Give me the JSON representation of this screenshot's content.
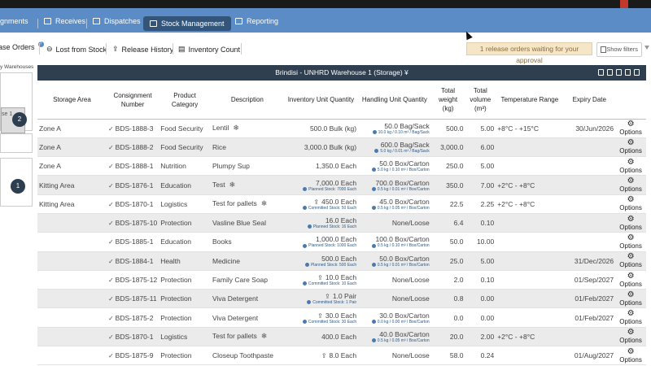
{
  "nav": {
    "items": [
      {
        "label": "ignments"
      },
      {
        "label": "Receives"
      },
      {
        "label": "Dispatches"
      },
      {
        "label": "Stock Management"
      },
      {
        "label": "Reporting"
      }
    ]
  },
  "toolbar": {
    "release_orders": "ase Orders",
    "release_orders_badge": "?",
    "lost_from_stock": "Lost from Stock",
    "release_history": "Release History",
    "inventory_count": "Inventory Count",
    "approval_notice": "1 release orders waiting for your approval",
    "show_filters": "Show filters"
  },
  "left_panel": {
    "title": "y Warehouses",
    "selected_label": "se 1",
    "node_1": "2",
    "node_2": "1"
  },
  "panel": {
    "title": "Brindisi - UNHRD Warehouse 1 (Storage) ¥"
  },
  "table": {
    "headers": [
      "Storage Area",
      "Consignment Number",
      "Product Category",
      "Description",
      "Inventory Unit Quantity",
      "Handling Unit Quantity",
      "Total weight (kg)",
      "Total volume (m³)",
      "Temperature Range",
      "Expiry Date",
      ""
    ],
    "options_label": "Options",
    "rows": [
      {
        "area": "Zone A",
        "cons": "BDS-1888-3",
        "cat": "Food Security",
        "desc": "Lentil",
        "snow": true,
        "share": false,
        "inv": "500.0 Bulk (kg)",
        "inv_sub": "",
        "hu": "50.0 Bag/Sack",
        "hu_sub": "10.0 kg / 0.10 m³ / Bag/Sack",
        "w": "500.0",
        "v": "5.00",
        "temp": "+8°C - +15°C",
        "exp": "30/Jun/2026"
      },
      {
        "area": "Zone A",
        "cons": "BDS-1888-2",
        "cat": "Food Security",
        "desc": "Rice",
        "snow": false,
        "share": false,
        "inv": "3,000.0 Bulk (kg)",
        "inv_sub": "",
        "hu": "600.0 Bag/Sack",
        "hu_sub": "5.0 kg / 0.01 m³ / Bag/Sack",
        "w": "3,000.0",
        "v": "6.00",
        "temp": "",
        "exp": ""
      },
      {
        "area": "Zone A",
        "cons": "BDS-1888-1",
        "cat": "Nutrition",
        "desc": "Plumpy Sup",
        "snow": false,
        "share": false,
        "inv": "1,350.0 Each",
        "inv_sub": "",
        "hu": "50.0 Box/Carton",
        "hu_sub": "5.0 kg / 0.10 m³ / Box/Carton",
        "w": "250.0",
        "v": "5.00",
        "temp": "",
        "exp": ""
      },
      {
        "area": "Kitting Area",
        "cons": "BDS-1876-1",
        "cat": "Education",
        "desc": "Test",
        "snow": true,
        "share": false,
        "inv": "7,000.0 Each",
        "inv_sub": "Planned Stock: 7000 Each",
        "hu": "700.0 Box/Carton",
        "hu_sub": "0.5 kg / 0.01 m³ / Box/Carton",
        "w": "350.0",
        "v": "7.00",
        "temp": "+2°C - +8°C",
        "exp": ""
      },
      {
        "area": "Kitting Area",
        "cons": "BDS-1870-1",
        "cat": "Logistics",
        "desc": "Test for pallets",
        "snow": true,
        "share": true,
        "inv": "450.0 Each",
        "inv_sub": "Committed Stock: 50 Each",
        "hu": "45.0 Box/Carton",
        "hu_sub": "0.5 kg / 0.05 m³ / Box/Carton",
        "w": "22.5",
        "v": "2.25",
        "temp": "+2°C - +8°C",
        "exp": ""
      },
      {
        "area": "",
        "cons": "BDS-1875-10",
        "cat": "Protection",
        "desc": "Vasline Blue Seal",
        "snow": false,
        "share": false,
        "inv": "16.0 Each",
        "inv_sub": "Planned Stock: 16 Each",
        "hu": "None/Loose",
        "hu_sub": "",
        "w": "6.4",
        "v": "0.10",
        "temp": "",
        "exp": ""
      },
      {
        "area": "",
        "cons": "BDS-1885-1",
        "cat": "Education",
        "desc": "Books",
        "snow": false,
        "share": false,
        "inv": "1,000.0 Each",
        "inv_sub": "Planned Stock: 1000 Each",
        "hu": "100.0 Box/Carton",
        "hu_sub": "0.5 kg / 0.10 m³ / Box/Carton",
        "w": "50.0",
        "v": "10.00",
        "temp": "",
        "exp": ""
      },
      {
        "area": "",
        "cons": "BDS-1884-1",
        "cat": "Health",
        "desc": "Medicine",
        "snow": false,
        "share": false,
        "inv": "500.0 Each",
        "inv_sub": "Planned Stock: 500 Each",
        "hu": "50.0 Box/Carton",
        "hu_sub": "0.5 kg / 0.01 m³ / Box/Carton",
        "w": "25.0",
        "v": "5.00",
        "temp": "",
        "exp": "31/Dec/2026"
      },
      {
        "area": "",
        "cons": "BDS-1875-12",
        "cat": "Protection",
        "desc": "Family Care Soap",
        "snow": false,
        "share": true,
        "inv": "10.0 Each",
        "inv_sub": "Committed Stock: 10 Each",
        "hu": "None/Loose",
        "hu_sub": "",
        "w": "2.0",
        "v": "0.10",
        "temp": "",
        "exp": "01/Sep/2027"
      },
      {
        "area": "",
        "cons": "BDS-1875-11",
        "cat": "Protection",
        "desc": "Viva Detergent",
        "snow": false,
        "share": true,
        "inv": "1.0 Pair",
        "inv_sub": "Committed Stock: 1 Pair",
        "hu": "None/Loose",
        "hu_sub": "",
        "w": "0.8",
        "v": "0.00",
        "temp": "",
        "exp": "01/Feb/2027"
      },
      {
        "area": "",
        "cons": "BDS-1875-2",
        "cat": "Protection",
        "desc": "Viva Detergent",
        "snow": false,
        "share": true,
        "inv": "30.0 Each",
        "inv_sub": "Committed Stock: 30 Each",
        "hu": "30.0 Box/Carton",
        "hu_sub": "0.0 kg / 0.00 m³ / Box/Carton",
        "w": "0.0",
        "v": "0.00",
        "temp": "",
        "exp": "01/Feb/2027"
      },
      {
        "area": "",
        "cons": "BDS-1870-1",
        "cat": "Logistics",
        "desc": "Test for pallets",
        "snow": true,
        "share": false,
        "inv": "400.0 Each",
        "inv_sub": "",
        "hu": "40.0 Box/Carton",
        "hu_sub": "0.5 kg / 0.05 m³ / Box/Carton",
        "w": "20.0",
        "v": "2.00",
        "temp": "+2°C - +8°C",
        "exp": ""
      },
      {
        "area": "",
        "cons": "BDS-1875-9",
        "cat": "Protection",
        "desc": "Closeup Toothpaste",
        "snow": false,
        "share": true,
        "inv": "8.0 Each",
        "inv_sub": "",
        "hu": "None/Loose",
        "hu_sub": "",
        "w": "58.0",
        "v": "0.24",
        "temp": "",
        "exp": "01/Aug/2027"
      }
    ]
  }
}
